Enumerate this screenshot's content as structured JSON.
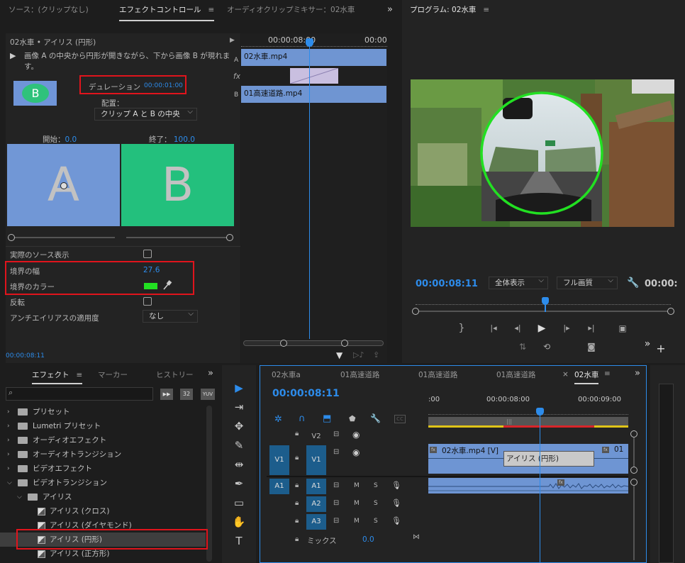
{
  "top_tabs": {
    "source": "ソース：(クリップなし)",
    "effect_controls": "エフェクトコントロール",
    "mixer": "オーディオクリップミキサー：02水車",
    "program": "プログラム: 02水車",
    "menu": "≡",
    "more": "»"
  },
  "ec": {
    "clip_title": "02水車 • アイリス (円形)",
    "description": "画像 A の中央から円形が開きながら、下から画像 B が現れます。",
    "duration_label": "デュレーション",
    "duration_value": "00:00:01:00",
    "alignment_label": "配置：",
    "alignment_value": "クリップ A と B の中央",
    "start_label": "開始：",
    "start_value": "0.0",
    "end_label": "終了：",
    "end_value": "100.0",
    "a_letter": "A",
    "b_letter": "B",
    "badge_letter": "B",
    "show_actual_label": "実際のソース表示",
    "border_width_label": "境界の幅",
    "border_width_value": "27.6",
    "border_color_label": "境界のカラー",
    "border_color": "#22e022",
    "reverse_label": "反転",
    "antialias_label": "アンチエイリアスの適用度",
    "antialias_value": "なし",
    "timecode": "00:00:08:11"
  },
  "mini_tl": {
    "time_cur": "00:00:08:00",
    "time_end": "00:00",
    "track_a": "A",
    "track_b": "B",
    "clip_a": "02水車.mp4",
    "clip_b": "01高速道路.mp4",
    "fx": "fx"
  },
  "program": {
    "timecode": "00:00:08:11",
    "zoom": "全体表示",
    "quality": "フル画質",
    "right_time": "00:00:"
  },
  "effects": {
    "tab_effects": "エフェクト",
    "tab_markers": "マーカー",
    "tab_history": "ヒストリー",
    "search_placeholder": "",
    "btn_accel": "▶▶",
    "btn_32": "32",
    "btn_yuv": "YUV",
    "tree": [
      {
        "label": "プリセット",
        "level": 0,
        "type": "star"
      },
      {
        "label": "Lumetri プリセット",
        "level": 0,
        "type": "star"
      },
      {
        "label": "オーディオエフェクト",
        "level": 0,
        "type": "folder"
      },
      {
        "label": "オーディオトランジション",
        "level": 0,
        "type": "folder"
      },
      {
        "label": "ビデオエフェクト",
        "level": 0,
        "type": "folder"
      },
      {
        "label": "ビデオトランジション",
        "level": 0,
        "type": "folder",
        "open": true
      },
      {
        "label": "アイリス",
        "level": 1,
        "type": "folder",
        "open": true
      },
      {
        "label": "アイリス (クロス)",
        "level": 2,
        "type": "fx"
      },
      {
        "label": "アイリス (ダイヤモンド)",
        "level": 2,
        "type": "fx"
      },
      {
        "label": "アイリス (円形)",
        "level": 2,
        "type": "fx",
        "selected": true
      },
      {
        "label": "アイリス (正方形)",
        "level": 2,
        "type": "fx"
      }
    ]
  },
  "timeline": {
    "seq_tabs": [
      "02水車a",
      "01高速道路",
      "01高速道路",
      "01高速道路",
      "02水車"
    ],
    "close": "×",
    "timecode": "00:00:08:11",
    "ruler": [
      ":00",
      "00:00:08:00",
      "00:00:09:00"
    ],
    "tracks": {
      "v2": "V2",
      "v1": "V1",
      "a1": "A1",
      "a2": "A2",
      "a3": "A3",
      "src_v1": "V1",
      "src_a1": "A1",
      "m": "M",
      "s": "S",
      "mix_label": "ミックス",
      "mix_value": "0.0"
    },
    "clip_v1": "02水車.mp4 [V]",
    "clip_v1_next": "01",
    "transition": "アイリス (円形)",
    "fx_badge": "fx"
  }
}
